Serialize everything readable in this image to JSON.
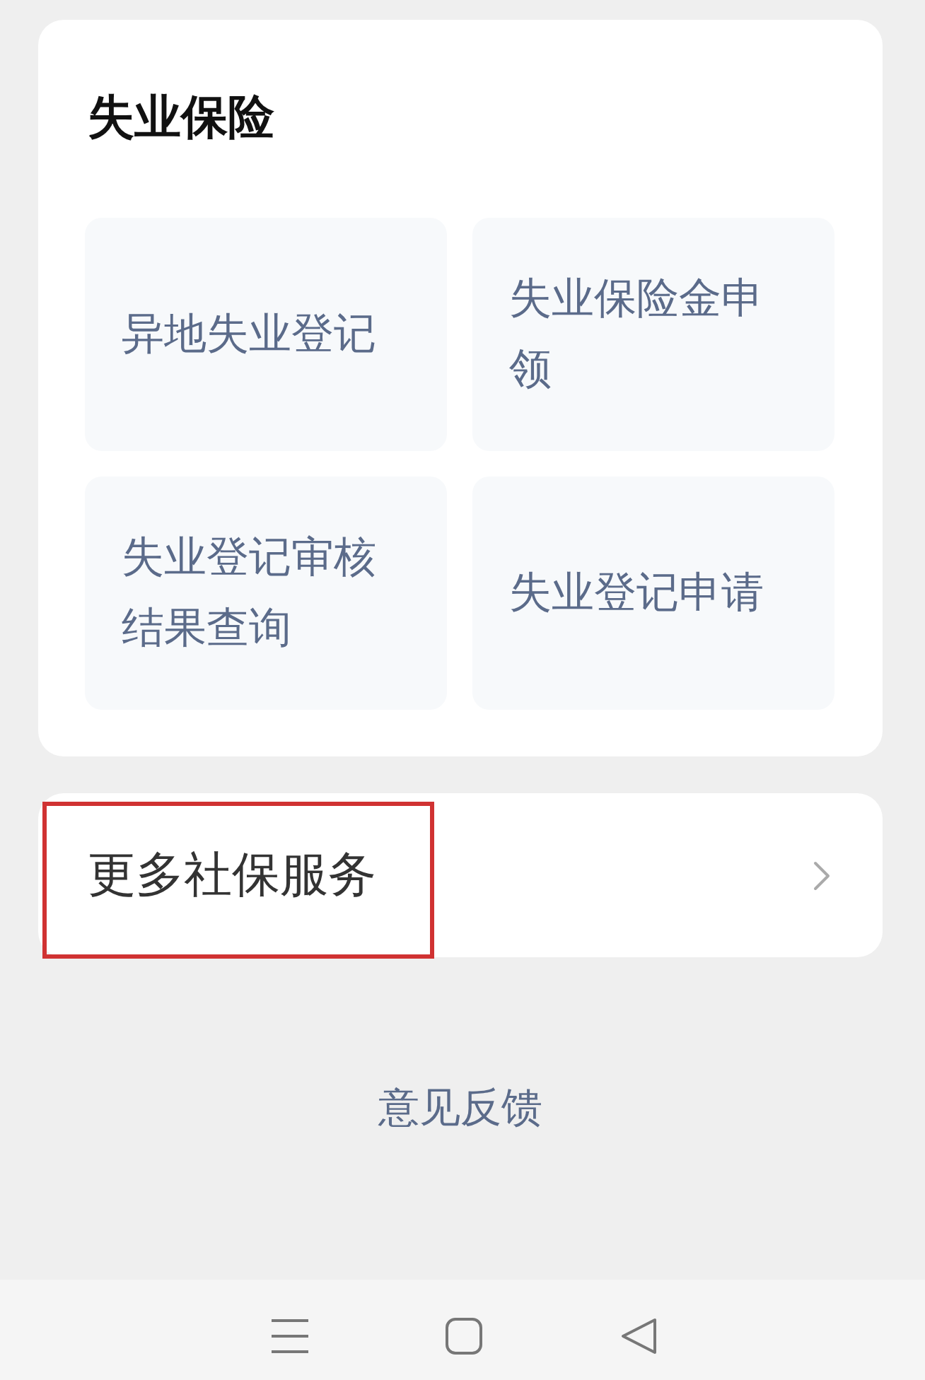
{
  "section": {
    "title": "失业保险",
    "tiles": [
      {
        "label": "异地失业登记"
      },
      {
        "label": "失业保险金申领"
      },
      {
        "label": "失业登记审核结果查询"
      },
      {
        "label": "失业登记申请"
      }
    ]
  },
  "more_services": {
    "label": "更多社保服务",
    "highlighted": true
  },
  "feedback": {
    "label": "意见反馈"
  }
}
